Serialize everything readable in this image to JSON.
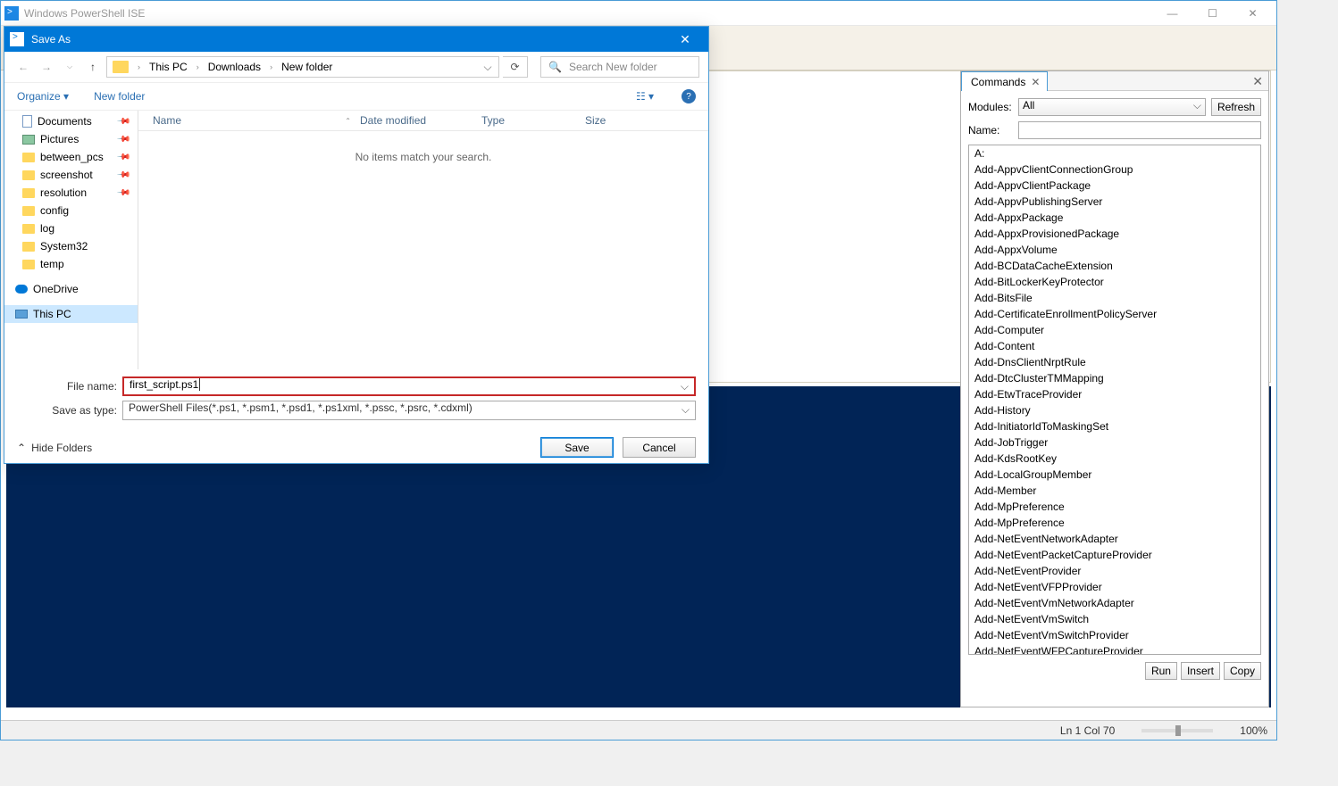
{
  "main": {
    "title": "Windows PowerShell ISE"
  },
  "saveDialog": {
    "title": "Save As",
    "breadcrumb": {
      "root": "This PC",
      "p1": "Downloads",
      "p2": "New folder"
    },
    "searchPlaceholder": "Search New folder",
    "organizeLabel": "Organize",
    "newFolderLabel": "New folder",
    "columns": {
      "name": "Name",
      "date": "Date modified",
      "type": "Type",
      "size": "Size"
    },
    "emptyMsg": "No items match your search.",
    "tree": {
      "documents": "Documents",
      "pictures": "Pictures",
      "between": "between_pcs",
      "screenshot": "screenshot",
      "resolution": "resolution",
      "config": "config",
      "log": "log",
      "system32": "System32",
      "temp": "temp",
      "onedrive": "OneDrive",
      "thispc": "This PC"
    },
    "fileNameLabel": "File name:",
    "fileNameValue": "first_script.ps1",
    "saveTypeLabel": "Save as type:",
    "saveTypeValue": "PowerShell Files(*.ps1, *.psm1, *.psd1, *.ps1xml, *.pssc, *.psrc, *.cdxml)",
    "hideFolders": "Hide Folders",
    "saveBtn": "Save",
    "cancelBtn": "Cancel"
  },
  "commands": {
    "tabLabel": "Commands",
    "modulesLabel": "Modules:",
    "modulesValue": "All",
    "refreshLabel": "Refresh",
    "nameLabel": "Name:",
    "list": [
      "A:",
      "Add-AppvClientConnectionGroup",
      "Add-AppvClientPackage",
      "Add-AppvPublishingServer",
      "Add-AppxPackage",
      "Add-AppxProvisionedPackage",
      "Add-AppxVolume",
      "Add-BCDataCacheExtension",
      "Add-BitLockerKeyProtector",
      "Add-BitsFile",
      "Add-CertificateEnrollmentPolicyServer",
      "Add-Computer",
      "Add-Content",
      "Add-DnsClientNrptRule",
      "Add-DtcClusterTMMapping",
      "Add-EtwTraceProvider",
      "Add-History",
      "Add-InitiatorIdToMaskingSet",
      "Add-JobTrigger",
      "Add-KdsRootKey",
      "Add-LocalGroupMember",
      "Add-Member",
      "Add-MpPreference",
      "Add-MpPreference",
      "Add-NetEventNetworkAdapter",
      "Add-NetEventPacketCaptureProvider",
      "Add-NetEventProvider",
      "Add-NetEventVFPProvider",
      "Add-NetEventVmNetworkAdapter",
      "Add-NetEventVmSwitch",
      "Add-NetEventVmSwitchProvider",
      "Add-NetEventWFPCaptureProvider"
    ],
    "runBtn": "Run",
    "insertBtn": "Insert",
    "copyBtn": "Copy"
  },
  "status": {
    "position": "Ln 1  Col 70",
    "zoom": "100%"
  }
}
